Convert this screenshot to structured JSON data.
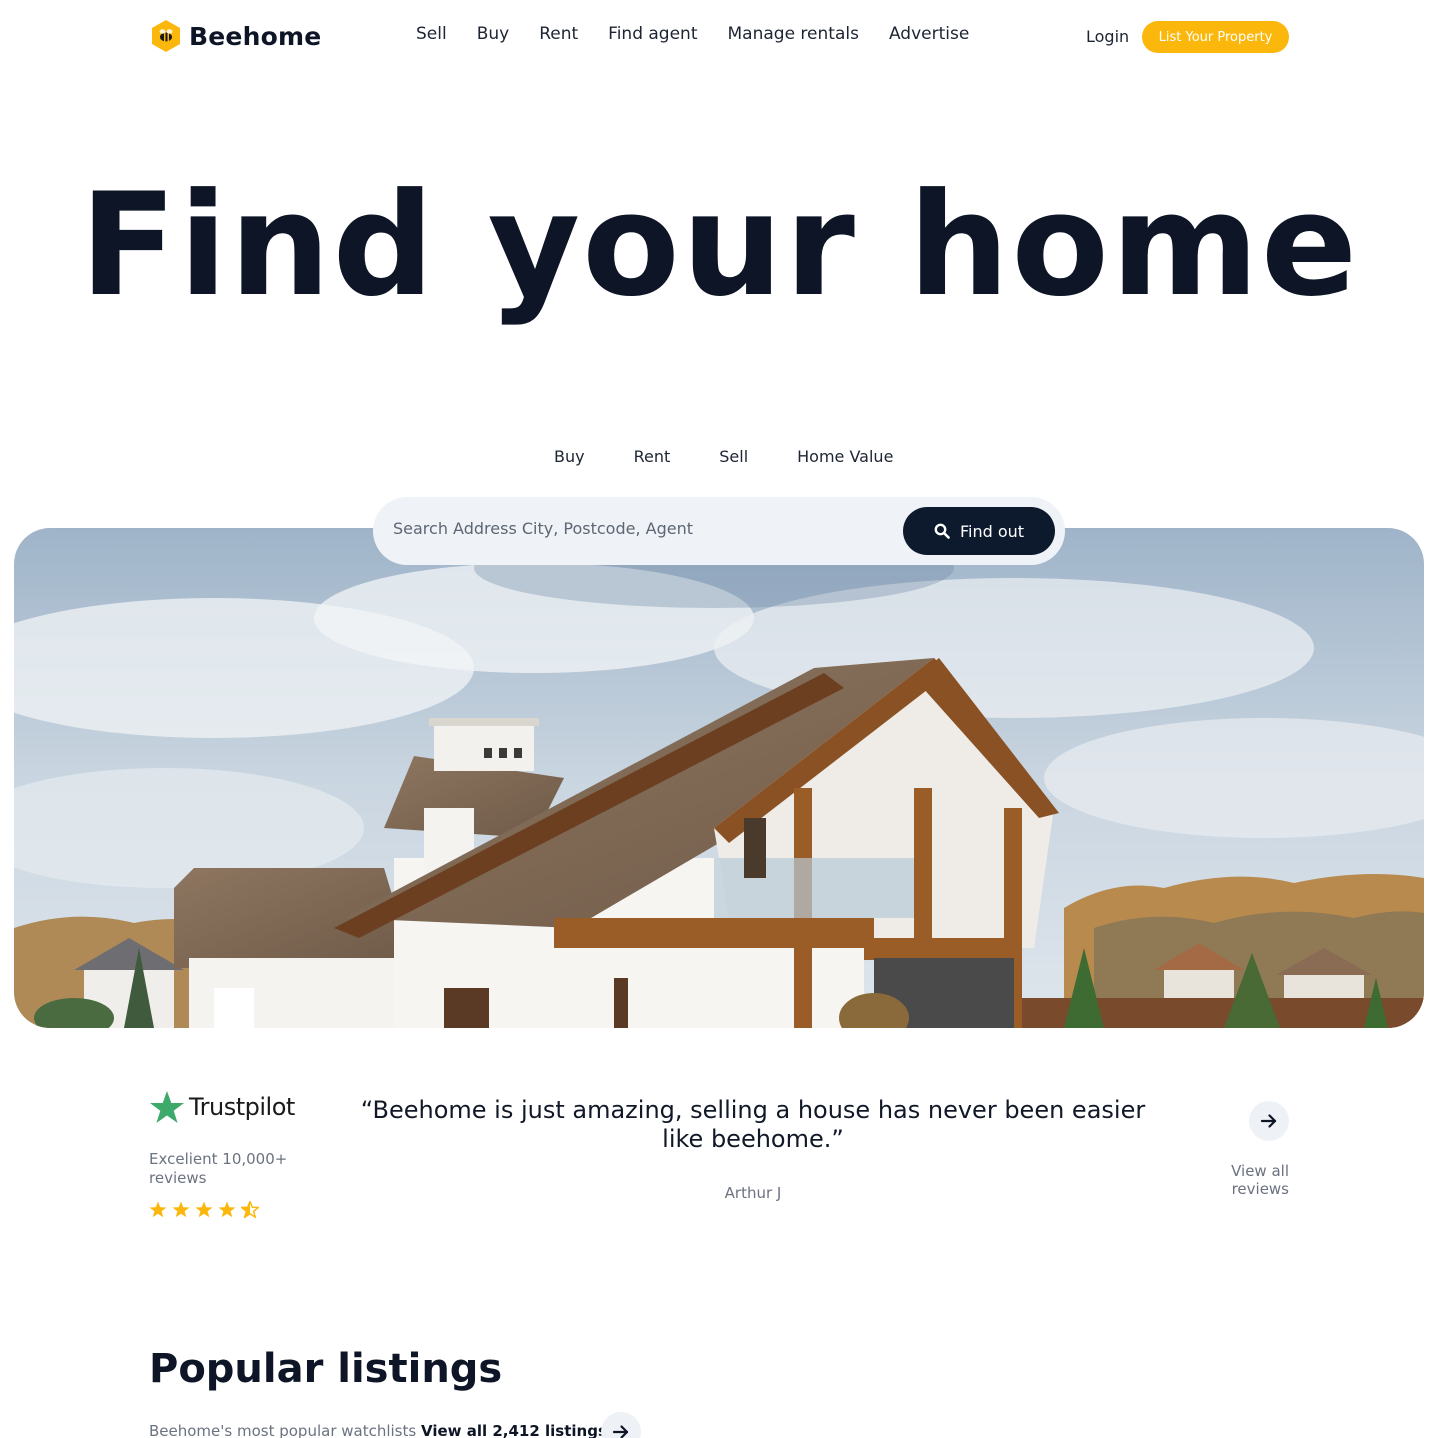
{
  "brand": {
    "name": "Beehome",
    "accent": "#fbb70b",
    "dark": "#0d1526"
  },
  "nav": {
    "items": [
      "Sell",
      "Buy",
      "Rent",
      "Find agent",
      "Manage rentals",
      "Advertise"
    ]
  },
  "header": {
    "login": "Login",
    "cta": "List Your Property"
  },
  "hero": {
    "title": "Find your home"
  },
  "tabs": [
    "Buy",
    "Rent",
    "Sell",
    "Home Value"
  ],
  "search": {
    "placeholder": "Search Address City, Postcode, Agent",
    "button": "Find out"
  },
  "trustpilot": {
    "brand": "Trustpilot",
    "summary": "Excelient 10,000+ reviews",
    "rating": 4.5,
    "quote": "“Beehome is just amazing, selling a house has never been easier like beehome.”",
    "author": "Arthur J",
    "view_all": "View all reviews"
  },
  "listings": {
    "title": "Popular listings",
    "subtitle": "Beehome's most popular watchlists",
    "view_all": "View all 2,412 listings"
  }
}
